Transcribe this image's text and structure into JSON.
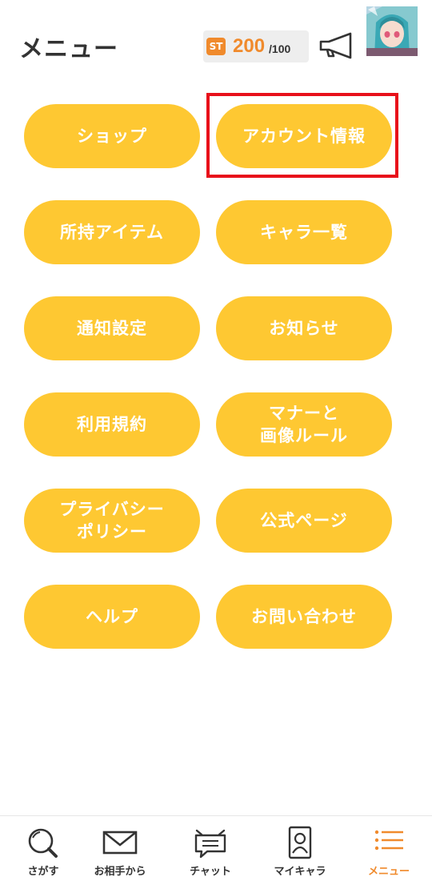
{
  "header": {
    "title": "メニュー",
    "stamina": {
      "badge": "ST",
      "value": "200",
      "max": "/100"
    },
    "icons": {
      "announce": "megaphone-icon",
      "avatar": "character-avatar"
    }
  },
  "menu": {
    "shop": "ショップ",
    "account": "アカウント情報",
    "items": "所持アイテム",
    "characters": "キャラ一覧",
    "notification_settings": "通知設定",
    "news": "お知らせ",
    "terms": "利用規約",
    "manners": "マナーと\n画像ルール",
    "privacy": "プライバシー\nポリシー",
    "official_page": "公式ページ",
    "help": "ヘルプ",
    "contact": "お問い合わせ"
  },
  "tabbar": {
    "search": "さがす",
    "from_partner": "お相手から",
    "chat": "チャット",
    "my_character": "マイキャラ",
    "menu": "メニュー"
  },
  "colors": {
    "button": "#fec832",
    "accent": "#f08a2c",
    "highlight": "#e8101a",
    "text": "#333333"
  }
}
